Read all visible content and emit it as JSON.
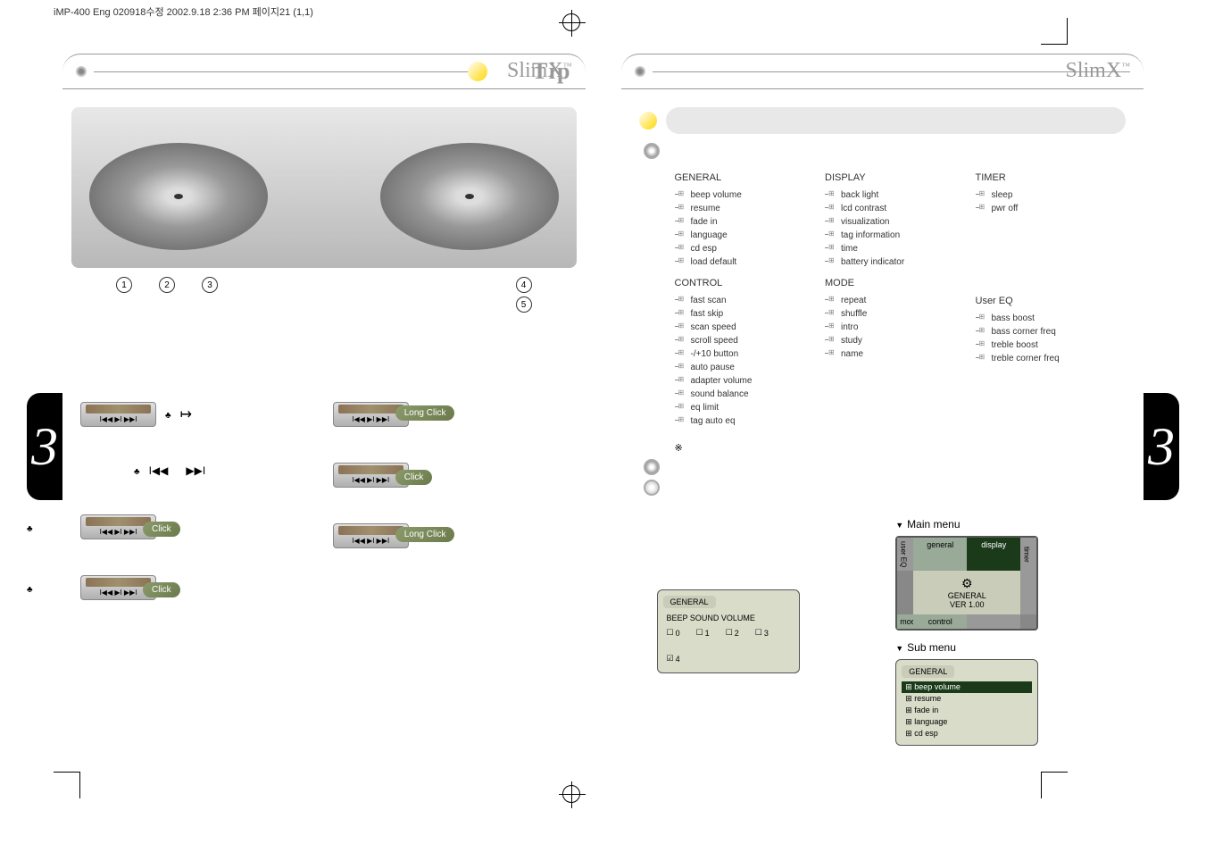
{
  "header_meta": "iMP-400 Eng 020918수정  2002.9.18 2:36 PM 페이지21 (1,1)",
  "left_page": {
    "tip_label": "Tip",
    "brand": "SlimX",
    "brand_tm": "™",
    "callouts": [
      "1",
      "2",
      "3",
      "4",
      "5"
    ],
    "click_label": "Click",
    "long_click_label": "Long Click",
    "side_number": "3"
  },
  "right_page": {
    "brand": "SlimX",
    "brand_tm": "™",
    "side_number": "3",
    "sections": {
      "general": {
        "title": "GENERAL",
        "bg": "1",
        "items": [
          "beep volume",
          "resume",
          "fade in",
          "language",
          "cd esp",
          "load default"
        ]
      },
      "display": {
        "title": "DISPLAY",
        "bg": "2",
        "items": [
          "back light",
          "lcd contrast",
          "visualization",
          "tag information",
          "time",
          "battery indicator"
        ]
      },
      "timer": {
        "title": "TIMER",
        "bg": "3",
        "items": [
          "sleep",
          "pwr off"
        ]
      },
      "control": {
        "title": "CONTROL",
        "bg": "4",
        "items": [
          "fast scan",
          "fast skip",
          "scan speed",
          "scroll speed",
          "-/+10 button",
          "auto pause",
          "adapter volume",
          "sound balance",
          "eq limit",
          "tag auto eq"
        ]
      },
      "mode": {
        "title": "MODE",
        "bg": "5",
        "items": [
          "repeat",
          "shuffle",
          "intro",
          "study",
          "name"
        ]
      },
      "usereq": {
        "title": "User EQ",
        "bg": "6",
        "items": [
          "bass boost",
          "bass corner freq",
          "treble boost",
          "treble corner freq"
        ]
      }
    },
    "preview_general": {
      "tab": "GENERAL",
      "subtitle": "BEEP SOUND VOLUME",
      "options": [
        "0",
        "1",
        "2",
        "3",
        "4"
      ],
      "selected": "4"
    },
    "preview_main": {
      "title": "Main menu",
      "tabs": {
        "tl": "general",
        "tr": "display",
        "bl": "mode",
        "br": "control",
        "left": "user EQ",
        "right": "timer"
      },
      "center_line1": "GENERAL",
      "center_line2": "VER 1.00"
    },
    "preview_sub": {
      "title": "Sub menu",
      "tab": "GENERAL",
      "items": [
        "beep volume",
        "resume",
        "fade in",
        "language",
        "cd esp"
      ],
      "selected": "beep volume"
    }
  }
}
